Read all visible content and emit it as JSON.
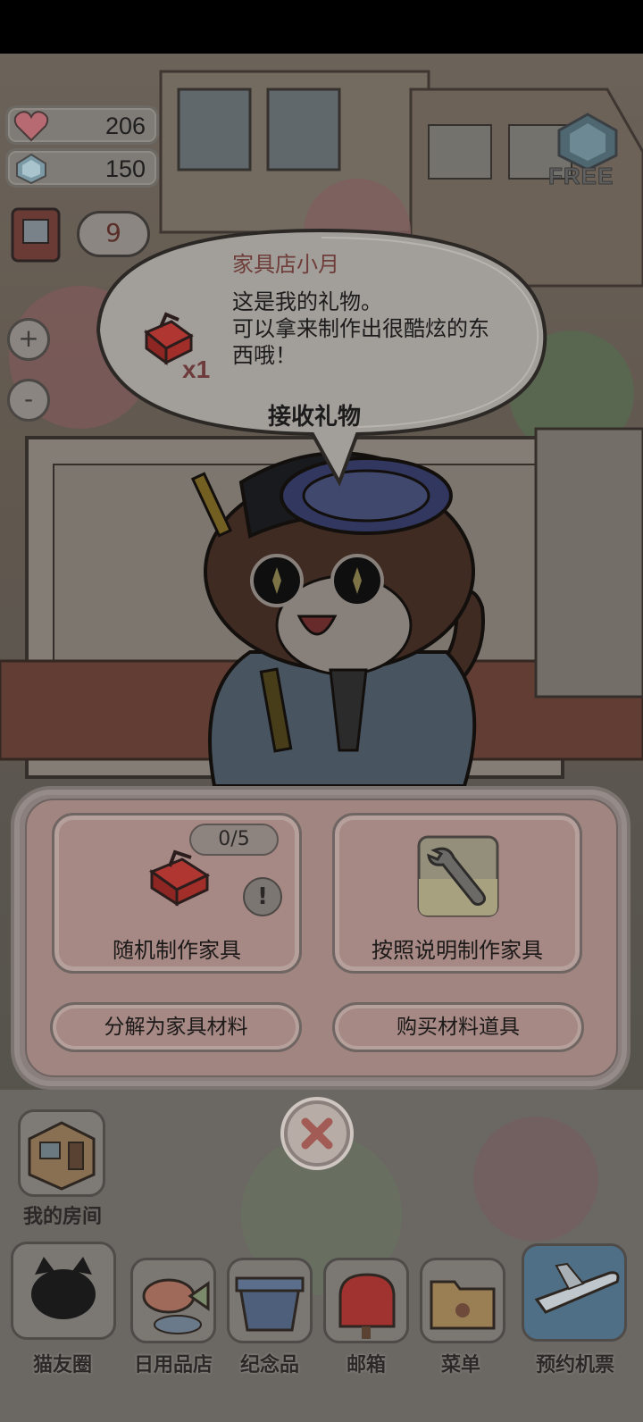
{
  "hud": {
    "hearts": "206",
    "gems": "150",
    "free_label": "FREE",
    "book_badge": "9",
    "zoom_in": "+",
    "zoom_out": "-"
  },
  "dialog": {
    "speaker": "家具店小月",
    "line1": "这是我的礼物。",
    "line2": "可以拿来制作出很酷炫的东",
    "line3": "西哦！",
    "gift_count": "x1",
    "accept_label": "接收礼物"
  },
  "craft_panel": {
    "random_count": "0/5",
    "random_label": "随机制作家具",
    "instructions_label": "按照说明制作家具",
    "decompose_label": "分解为家具材料",
    "buy_label": "购买材料道具",
    "alert_symbol": "!"
  },
  "bottom": {
    "my_room": "我的房间",
    "dock": [
      {
        "label": "猫友圈"
      },
      {
        "label": "日用品店"
      },
      {
        "label": "纪念品"
      },
      {
        "label": "邮箱"
      },
      {
        "label": "菜单"
      },
      {
        "label": "预约机票"
      }
    ]
  },
  "colors": {
    "accent_red": "#c0332f",
    "panel_pink": "#a68884",
    "overlay": "rgba(0,0,0,0.42)"
  }
}
